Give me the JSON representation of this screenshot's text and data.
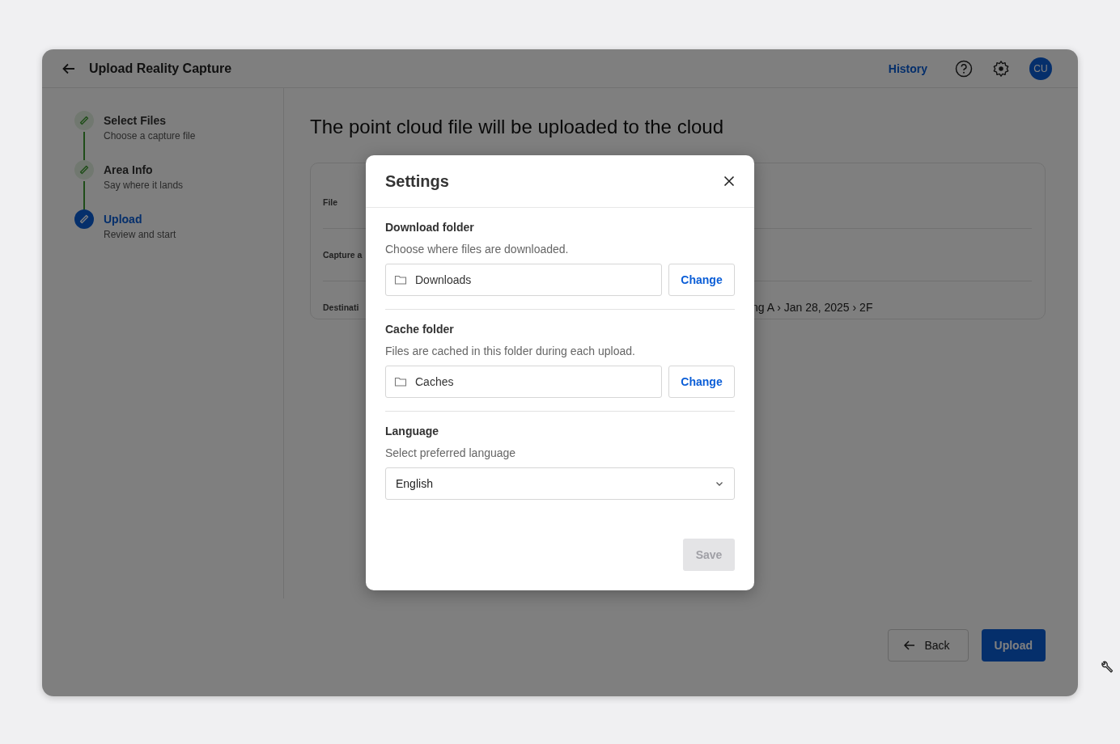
{
  "header": {
    "title": "Upload Reality Capture",
    "history_link": "History",
    "avatar": "CU"
  },
  "steps": [
    {
      "title": "Select Files",
      "subtitle": "Choose a capture file",
      "completed": true,
      "selected": false
    },
    {
      "title": "Area Info",
      "subtitle": "Say where it lands",
      "completed": true,
      "selected": false
    },
    {
      "title": "Upload",
      "subtitle": "Review and start",
      "completed": false,
      "selected": true
    }
  ],
  "main": {
    "heading": "The point cloud file will be uploaded to the cloud",
    "rows": [
      {
        "label": "File"
      },
      {
        "label": "Capture a"
      },
      {
        "label": "Destinati",
        "value": "ng A › Jan 28, 2025 › 2F"
      }
    ]
  },
  "footer": {
    "back": "Back",
    "upload": "Upload"
  },
  "dialog": {
    "title": "Settings",
    "sections": [
      {
        "kind": "folder",
        "title": "Download folder",
        "description": "Choose where files are downloaded.",
        "value": "Downloads",
        "action": "Change"
      },
      {
        "kind": "folder",
        "title": "Cache folder",
        "description": "Files are cached in this folder during each upload.",
        "value": "Caches",
        "action": "Change"
      },
      {
        "kind": "select",
        "title": "Language",
        "description": "Select preferred language",
        "value": "English"
      }
    ],
    "save": {
      "label": "Save",
      "disabled": true
    }
  }
}
